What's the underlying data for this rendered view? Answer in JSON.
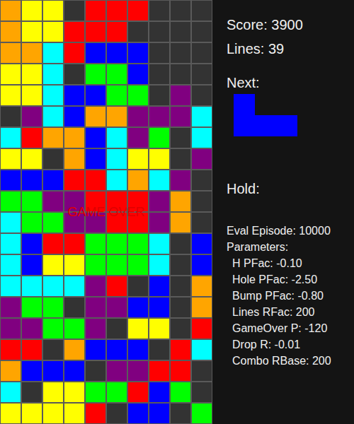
{
  "board": {
    "rows": [
      [
        "#FFA500",
        "#FFFF00",
        "#FFFF00",
        null,
        "#FF0000",
        "#FF0000",
        "#FF0000",
        null,
        null,
        null
      ],
      [
        "#FFA500",
        "#FFFF00",
        "#FFFF00",
        "#FF0000",
        "#FF0000",
        "#FF0000",
        null,
        null,
        null,
        null
      ],
      [
        "#FFA500",
        "#FFA500",
        "#00FFFF",
        "#FF0000",
        "#0000FF",
        "#0000FF",
        "#0000FF",
        null,
        null,
        null
      ],
      [
        "#FFFF00",
        "#FFFF00",
        "#00FFFF",
        null,
        "#00FF00",
        "#00FF00",
        "#0000FF",
        null,
        null,
        null
      ],
      [
        "#FFFF00",
        "#FFFF00",
        "#00FFFF",
        "#0000FF",
        "#0000FF",
        "#00FF00",
        "#00FF00",
        null,
        "#800080",
        null
      ],
      [
        null,
        "#800080",
        "#00FFFF",
        "#0000FF",
        "#FFA500",
        "#FFA500",
        "#800080",
        "#800080",
        "#800080",
        "#00FFFF"
      ],
      [
        "#00FFFF",
        "#FF0000",
        "#FFA500",
        "#FFA500",
        "#0000FF",
        "#00FFFF",
        "#800080",
        "#00FF00",
        null,
        "#00FFFF"
      ],
      [
        "#FFFF00",
        "#FFFF00",
        null,
        "#FFA500",
        "#0000FF",
        "#00FFFF",
        "#FFFF00",
        "#FFFF00",
        null,
        "#800080"
      ],
      [
        "#0000FF",
        "#0000FF",
        "#0000FF",
        "#FF0000",
        "#FF0000",
        "#00FFFF",
        "#FFA500",
        "#00FFFF",
        "#800080",
        null
      ],
      [
        "#00FF00",
        "#00FF00",
        "#800080",
        "#800080",
        "#FF0000",
        "#FF0000",
        "#FF0000",
        "#800080",
        "#FFA500",
        null
      ],
      [
        "#00FFFF",
        "#00FF00",
        "#00FF00",
        "#800080",
        "#800080",
        "#FF0000",
        "#FF0000",
        "#800080",
        "#FFA500",
        null
      ],
      [
        "#00FFFF",
        "#0000FF",
        "#FF0000",
        "#FF0000",
        "#00FF00",
        "#00FF00",
        "#00FF00",
        "#00FFFF",
        null,
        "#0000FF"
      ],
      [
        "#00FFFF",
        "#0000FF",
        "#FFFF00",
        "#FFFF00",
        "#00FF00",
        "#00FF00",
        "#00FF00",
        "#00FFFF",
        null,
        "#0000FF"
      ],
      [
        "#00FFFF",
        "#00FFFF",
        "#00FFFF",
        "#00FFFF",
        "#800080",
        "#FF0000",
        null,
        "#0000FF",
        null,
        "#FFA500"
      ],
      [
        "#800080",
        "#00FF00",
        "#00FF00",
        null,
        "#800080",
        "#800080",
        "#0000FF",
        "#0000FF",
        null,
        "#FFA500"
      ],
      [
        "#800080",
        "#800080",
        "#00FF00",
        "#00FF00",
        "#800080",
        null,
        "#FFFF00",
        "#FFFF00",
        null,
        "#FF0000"
      ],
      [
        "#FF0000",
        "#FF0000",
        null,
        "#FFA500",
        "#0000FF",
        "#0000FF",
        "#0000FF",
        null,
        "#FF0000",
        "#00FFFF"
      ],
      [
        "#FFA500",
        "#0000FF",
        "#0000FF",
        "#0000FF",
        null,
        "#800080",
        "#800080",
        "#FF0000",
        "#FF0000",
        null
      ],
      [
        "#00FFFF",
        null,
        "#FFFF00",
        "#FFFF00",
        "#00FF00",
        "#00FF00",
        "#FF0000",
        "#0000FF",
        "#00FF00",
        null
      ],
      [
        "#FFFF00",
        "#FFFF00",
        "#FFFF00",
        "#FFFF00",
        "#FF0000",
        null,
        "#0000FF",
        "#0000FF",
        null,
        "#00FF00"
      ]
    ]
  },
  "game_over": "GAME OVER",
  "score": "Score: 3900",
  "lines": "Lines: 39",
  "next": {
    "label": "Next:",
    "color": "#0000FF",
    "shape": [
      [
        true,
        false,
        false
      ],
      [
        true,
        true,
        true
      ]
    ]
  },
  "hold": {
    "label": "Hold:"
  },
  "episode": "Eval Episode: 10000",
  "parameters": {
    "label": "Parameters:",
    "items": [
      "H PFac: -0.10",
      "Hole PFac: -2.50",
      "Bump PFac: -0.80",
      "Lines RFac: 200",
      "GameOver P: -120",
      "Drop R: -0.01",
      "Combo RBase: 200"
    ]
  }
}
